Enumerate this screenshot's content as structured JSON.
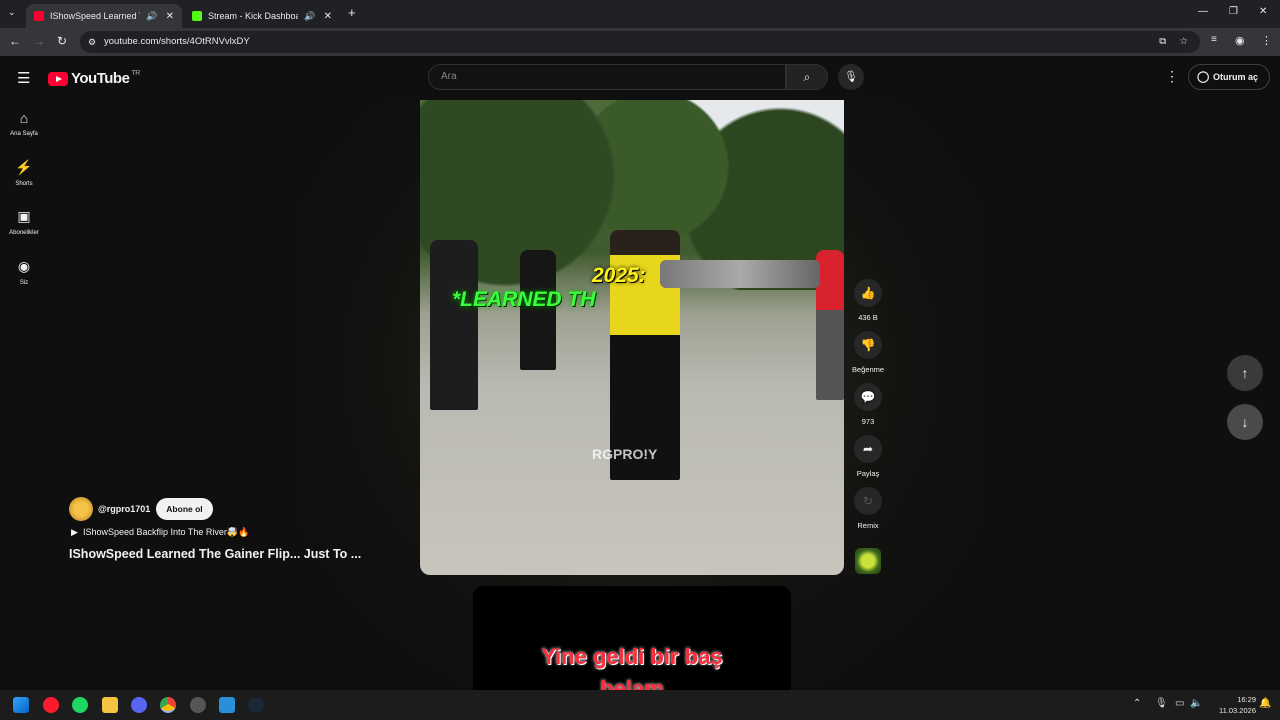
{
  "browser": {
    "tabs": [
      {
        "title": "IShowSpeed Learned The G",
        "active": true
      },
      {
        "title": "Stream - Kick Dashboard",
        "active": false
      }
    ],
    "url": "youtube.com/shorts/4OtRNVvlxDY"
  },
  "youtube": {
    "logo_text": "YouTube",
    "region": "TR",
    "search_placeholder": "Ara",
    "signin_label": "Oturum aç",
    "sidebar": [
      {
        "label": "Ana Sayfa",
        "icon": "home-icon"
      },
      {
        "label": "Shorts",
        "icon": "shorts-icon"
      },
      {
        "label": "Abonelikler",
        "icon": "subscriptions-icon"
      },
      {
        "label": "Siz",
        "icon": "you-icon"
      }
    ]
  },
  "short": {
    "overlay_line1": "2025:",
    "overlay_line2": "*LEARNED TH",
    "watermark": "RGPRO!Y",
    "channel_handle": "@rgpro1701",
    "subscribe_label": "Abone ol",
    "sound_label": "IShowSpeed Backflip Into The River🤯🔥",
    "title": "IShowSpeed Learned The Gainer Flip... Just To ...",
    "actions": {
      "like_count": "436 B",
      "dislike_label": "Beğenme",
      "comments_count": "973",
      "share_label": "Paylaş",
      "remix_label": "Remix"
    }
  },
  "next_short": {
    "caption_line1": "Yine geldi bir baş",
    "caption_line2": "belam"
  },
  "taskbar": {
    "time": "16:29",
    "date": "11.03.2026"
  }
}
